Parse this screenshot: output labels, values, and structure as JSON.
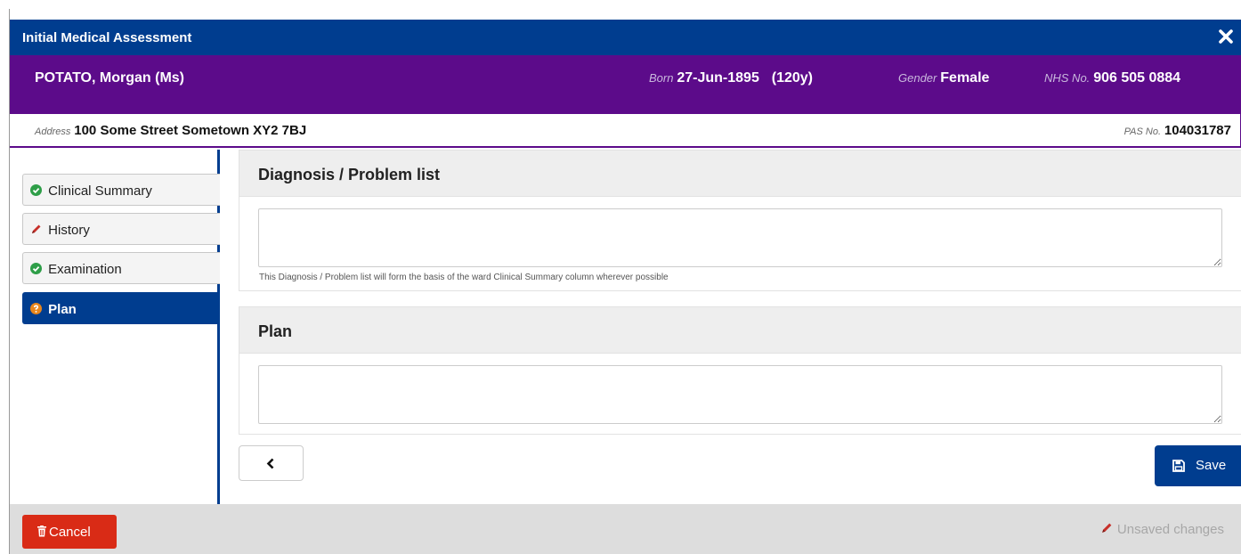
{
  "dialog": {
    "title": "Initial Medical Assessment",
    "close_icon": "close-icon",
    "accent_color": "#003d8f",
    "patient_color": "#5c0b8a"
  },
  "patient": {
    "name": "POTATO, Morgan (Ms)",
    "born_label": "Born",
    "born": "27-Jun-1895",
    "age": "(120y)",
    "gender_label": "Gender",
    "gender": "Female",
    "nhs_label": "NHS No.",
    "nhs": "906 505 0884",
    "address_label": "Address",
    "address": "100 Some Street Sometown XY2 7BJ",
    "pas_label": "PAS No.",
    "pas": "104031787"
  },
  "sidebar": {
    "items": [
      {
        "label": "Clinical Summary",
        "icon": "check-circle-icon",
        "status": "complete",
        "active": false
      },
      {
        "label": "History",
        "icon": "pencil-icon",
        "status": "edited",
        "active": false
      },
      {
        "label": "Examination",
        "icon": "check-circle-icon",
        "status": "complete",
        "active": false
      },
      {
        "label": "Plan",
        "icon": "question-circle-icon",
        "status": "incomplete",
        "active": true
      }
    ]
  },
  "sections": {
    "diagnosis": {
      "title": "Diagnosis / Problem list",
      "value": "",
      "help": "This Diagnosis / Problem list will form the basis of the ward Clinical Summary column wherever possible"
    },
    "plan": {
      "title": "Plan",
      "value": ""
    }
  },
  "actions": {
    "back_icon": "chevron-left-icon",
    "save_label": "Save",
    "save_icon": "floppy-disk-icon",
    "cancel_label": "Cancel",
    "cancel_icon": "trash-icon",
    "cancel_color": "#d92b16",
    "unsaved_label": "Unsaved changes",
    "unsaved_icon": "pencil-icon"
  }
}
